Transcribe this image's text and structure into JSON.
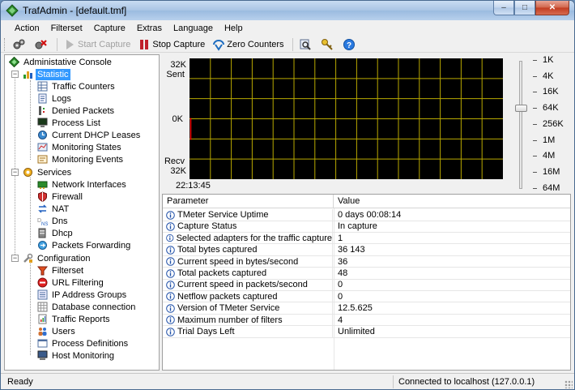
{
  "window": {
    "title": "TrafAdmin - [default.tmf]",
    "minimize": "–",
    "maximize": "□",
    "close": "✕"
  },
  "menu": [
    "Action",
    "Filterset",
    "Capture",
    "Extras",
    "Language",
    "Help"
  ],
  "toolbar": {
    "start_capture": "Start Capture",
    "stop_capture": "Stop Capture",
    "zero_counters": "Zero Counters"
  },
  "tree": {
    "root": "Administative Console",
    "statistic": {
      "label": "Statistic",
      "items": [
        "Traffic Counters",
        "Logs",
        "Denied Packets",
        "Process List",
        "Current DHCP Leases",
        "Monitoring States",
        "Monitoring Events"
      ]
    },
    "services": {
      "label": "Services",
      "items": [
        "Network Interfaces",
        "Firewall",
        "NAT",
        "Dns",
        "Dhcp",
        "Packets Forwarding"
      ]
    },
    "configuration": {
      "label": "Configuration",
      "items": [
        "Filterset",
        "URL Filtering",
        "IP Address Groups",
        "Database connection",
        "Traffic Reports",
        "Users",
        "Process Definitions",
        "Host Monitoring"
      ]
    }
  },
  "graph": {
    "sent_value": "32K",
    "sent_label": "Sent",
    "zero": "0K",
    "recv_label": "Recv",
    "recv_value": "32K",
    "time": "22:13:45",
    "scale": [
      "1K",
      "4K",
      "16K",
      "64K",
      "256K",
      "1M",
      "4M",
      "16M",
      "64M"
    ],
    "scale_selected_index": 3,
    "colors": {
      "background": "#000000",
      "grid": "#b8a800",
      "trace": "#ff0000"
    }
  },
  "grid": {
    "columns": [
      "Parameter",
      "Value"
    ],
    "rows": [
      [
        "TMeter Service Uptime",
        "0 days 00:08:14"
      ],
      [
        "Capture Status",
        "In capture"
      ],
      [
        "Selected adapters for the traffic capture",
        "1"
      ],
      [
        "Total bytes captured",
        "36 143"
      ],
      [
        "Current speed in bytes/second",
        "36"
      ],
      [
        "Total packets captured",
        "48"
      ],
      [
        "Current speed in packets/second",
        "0"
      ],
      [
        "Netflow packets captured",
        "0"
      ],
      [
        "Version of TMeter Service",
        "12.5.625"
      ],
      [
        "Maximum number of filters",
        "4"
      ],
      [
        "Trial Days Left",
        "Unlimited"
      ]
    ]
  },
  "status": {
    "left": "Ready",
    "right": "Connected to localhost (127.0.0.1)"
  }
}
